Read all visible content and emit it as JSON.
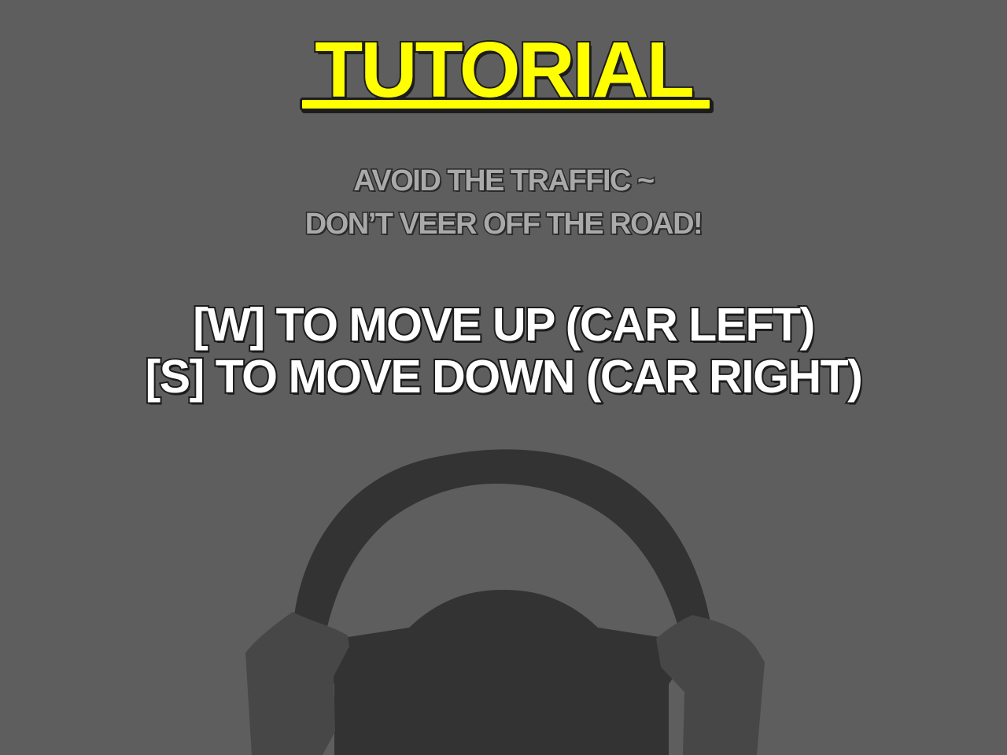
{
  "tutorial": {
    "title": "TUTORIAL",
    "hint_lines": [
      "AVOID THE TRAFFIC ~",
      "DON’T VEER OFF THE ROAD!"
    ],
    "control_lines": [
      "[W] TO MOVE UP (CAR LEFT)",
      "[S] TO MOVE DOWN (CAR RIGHT)"
    ]
  },
  "colors": {
    "background": "#5e5e5e",
    "title": "#ffff00",
    "hint_text": "#a9a9a9",
    "control_text": "#ffffff",
    "outline": "#1c1c1c",
    "steering_wheel": "#333333",
    "hands": "#474747"
  },
  "icons": {
    "illustration": "steering-wheel-icon"
  }
}
